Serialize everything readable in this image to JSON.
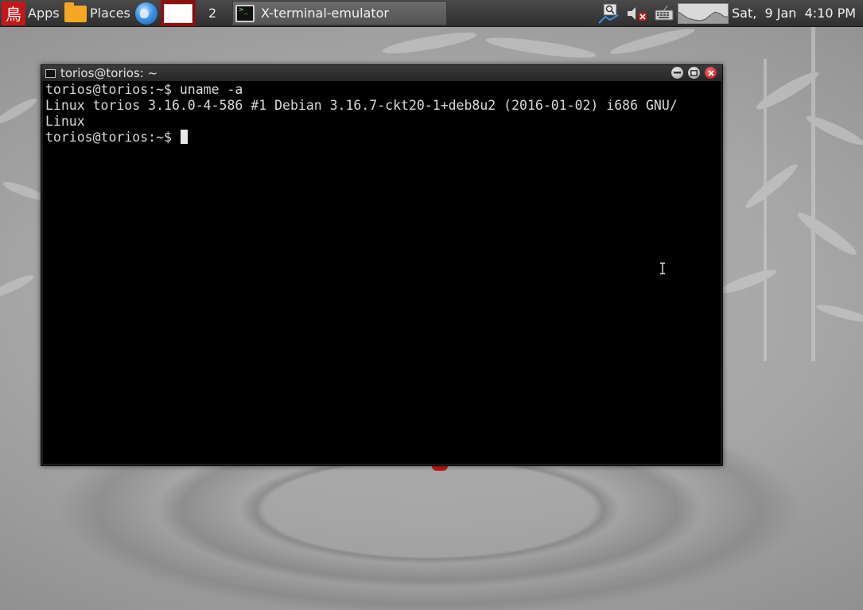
{
  "panel": {
    "apps_logo_glyph": "鳥",
    "apps_label": "Apps",
    "places_label": "Places",
    "workspace_number": "2",
    "taskbar_item_label": "X-terminal-emulator",
    "clock": "Sat,  9 Jan  4:10 PM",
    "icons": {
      "apps": "torios-logo-icon",
      "places": "folder-icon",
      "browser": "globe-icon",
      "pager": "workspace-pager",
      "network": "network-icon",
      "volume": "volume-muted-icon",
      "keyboard": "keyboard-icon",
      "cpu": "cpu-graph-monitor"
    }
  },
  "terminal": {
    "title": "torios@torios: ~",
    "lines": [
      "torios@torios:~$ uname -a",
      "Linux torios 3.16.0-4-586 #1 Debian 3.16.7-ckt20-1+deb8u2 (2016-01-02) i686 GNU/",
      "Linux",
      "torios@torios:~$ "
    ]
  },
  "colors": {
    "panel": "#2f2f2f",
    "accent_red": "#c41818",
    "terminal_bg": "#000000",
    "terminal_fg": "#d8d8d8"
  }
}
